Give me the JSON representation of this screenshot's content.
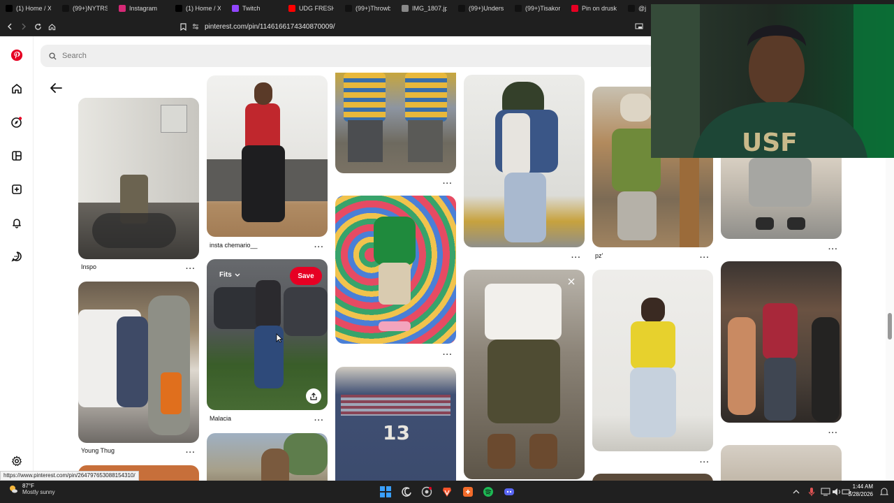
{
  "browser": {
    "tabs": [
      {
        "label": "(1) Home / X",
        "icon": "x-icon",
        "color": "#000000"
      },
      {
        "label": "(99+)NYTRSA",
        "icon": "tiktok-icon",
        "color": "#111111"
      },
      {
        "label": "Instagram",
        "icon": "instagram-icon",
        "color": "#d62976"
      },
      {
        "label": "(1) Home / X",
        "icon": "x-icon",
        "color": "#000000"
      },
      {
        "label": "Twitch",
        "icon": "twitch-icon",
        "color": "#9146ff"
      },
      {
        "label": "UDG FRESHM",
        "icon": "youtube-icon",
        "color": "#ff0000"
      },
      {
        "label": "(99+)Throwb",
        "icon": "tiktok-icon",
        "color": "#111111"
      },
      {
        "label": "IMG_1807.jpg",
        "icon": "globe-icon",
        "color": "#888888"
      },
      {
        "label": "(99+)Underst",
        "icon": "tiktok-icon",
        "color": "#111111"
      },
      {
        "label": "(99+)Tisakore",
        "icon": "tiktok-icon",
        "color": "#111111"
      },
      {
        "label": "Pin on druski",
        "icon": "pinterest-icon",
        "color": "#e60023"
      },
      {
        "label": "@j",
        "icon": "tiktok-icon",
        "color": "#111111"
      }
    ],
    "url": "pinterest.com/pin/1146166174340870009/"
  },
  "search": {
    "placeholder": "Search"
  },
  "pins": [
    {
      "label": "Inspo"
    },
    {
      "label": "Young Thug"
    },
    {
      "label": "insta chemario__"
    },
    {
      "label": "Malacia"
    },
    {
      "label": "pz'"
    }
  ],
  "hover_pin": {
    "board": "Fits",
    "save": "Save"
  },
  "status_url": "https://www.pinterest.com/pin/264797653088154310/",
  "weather": {
    "temp": "87°F",
    "condition": "Mostly sunny"
  },
  "clock": {
    "time": "1:44 AM",
    "date": "3/28/2026"
  },
  "colors": {
    "pinterest_red": "#e60023"
  }
}
